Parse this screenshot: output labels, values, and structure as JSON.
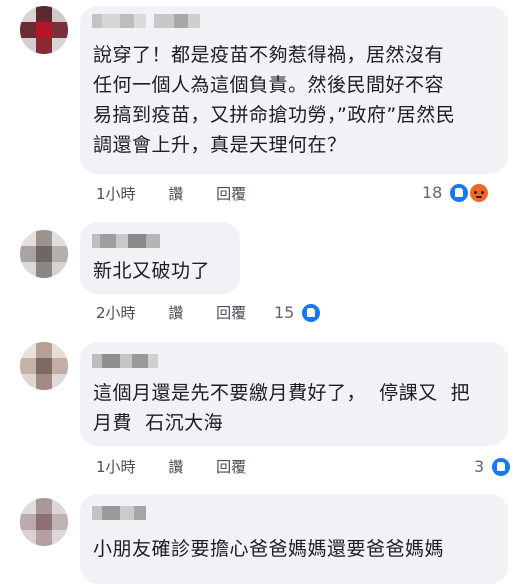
{
  "comments": [
    {
      "text": "說穿了！都是疫苗不夠惹得禍，居然沒有\n任何一個人為這個負責。然後民間好不容\n易搞到疫苗，又拼命搶功勞，”政府”居然民\n調還會上升，真是天理何在？",
      "time": "1小時",
      "like": "讚",
      "reply": "回覆",
      "reaction_count": "18",
      "reaction_icons": [
        "like-icon",
        "angry-icon"
      ]
    },
    {
      "text": "新北又破功了",
      "time": "2小時",
      "like": "讚",
      "reply": "回覆",
      "reaction_count": "15",
      "reaction_icons": [
        "like-icon"
      ]
    },
    {
      "text": "這個月還是先不要繳月費好了，  停課又  把\n月費  石沉大海",
      "time": "1小時",
      "like": "讚",
      "reply": "回覆",
      "reaction_count": "3",
      "reaction_icons": [
        "like-icon"
      ]
    },
    {
      "text": "小朋友確診要擔心爸爸媽媽還要爸爸媽媽",
      "time": "",
      "like": "",
      "reply": "",
      "reaction_count": "",
      "reaction_icons": []
    }
  ],
  "colors": {
    "bubble": "#f0f2f5",
    "text": "#1c1e21",
    "meta": "#4b4f56",
    "like_blue": "#1877f2",
    "angry_orange": "#f0662b"
  }
}
